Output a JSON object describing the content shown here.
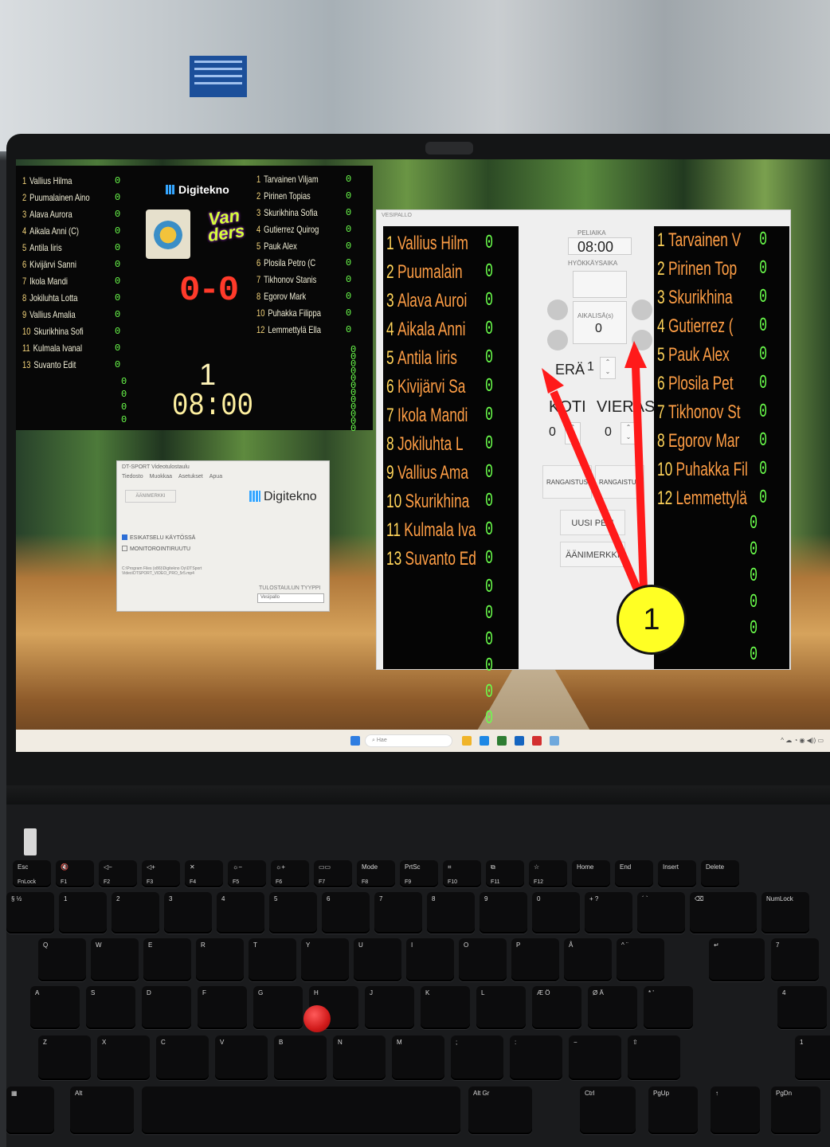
{
  "scoreboard": {
    "home_players": [
      {
        "num": "1",
        "name": "Vallius Hilma",
        "score": "0"
      },
      {
        "num": "2",
        "name": "Puumalainen Aino",
        "score": "0"
      },
      {
        "num": "3",
        "name": "Alava Aurora",
        "score": "0"
      },
      {
        "num": "4",
        "name": "Aikala Anni (C)",
        "score": "0"
      },
      {
        "num": "5",
        "name": "Antila Iiris",
        "score": "0"
      },
      {
        "num": "6",
        "name": "Kivijärvi Sanni",
        "score": "0"
      },
      {
        "num": "7",
        "name": "Ikola Mandi",
        "score": "0"
      },
      {
        "num": "8",
        "name": "Jokiluhta Lotta",
        "score": "0"
      },
      {
        "num": "9",
        "name": "Vallius Amalia",
        "score": "0"
      },
      {
        "num": "10",
        "name": "Skurikhina Sofi",
        "score": "0"
      },
      {
        "num": "11",
        "name": "Kulmala Ivanal",
        "score": "0"
      },
      {
        "num": "13",
        "name": "Suvanto Edit",
        "score": "0"
      }
    ],
    "away_players": [
      {
        "num": "1",
        "name": "Tarvainen Viljam",
        "score": "0"
      },
      {
        "num": "2",
        "name": "Pirinen Topias",
        "score": "0"
      },
      {
        "num": "3",
        "name": "Skurikhina Sofia",
        "score": "0"
      },
      {
        "num": "4",
        "name": "Gutierrez Quirog",
        "score": "0"
      },
      {
        "num": "5",
        "name": "Pauk Alex",
        "score": "0"
      },
      {
        "num": "6",
        "name": "Plosila Petro (C",
        "score": "0"
      },
      {
        "num": "7",
        "name": "Tikhonov Stanis",
        "score": "0"
      },
      {
        "num": "8",
        "name": "Egorov Mark",
        "score": "0"
      },
      {
        "num": "10",
        "name": "Puhakka Filippa",
        "score": "0"
      },
      {
        "num": "12",
        "name": "Lemmettylä Ella",
        "score": "0"
      }
    ],
    "extra_zeros": [
      "0",
      "0",
      "0",
      "0",
      "0",
      "0",
      "0",
      "0",
      "0",
      "0",
      "0",
      "0",
      "0",
      "0",
      "0",
      "0"
    ],
    "brand": "Digitekno",
    "logo_b_text": "Van ders",
    "score": "0-0",
    "period": "1",
    "clock": "08:00"
  },
  "dialog": {
    "title": "DT-SPORT Videotulostaulu",
    "menu": [
      "Tiedosto",
      "Muokkaa",
      "Asetukset",
      "Apua"
    ],
    "sound_button": "ÄÄNIMERKKI",
    "brand": "Digitekno",
    "preview_checkbox": "ESIKATSELU KÄYTÖSSÄ",
    "monitor_checkbox": "MONITOROINTIRUUTU",
    "file_path": "C:\\Program Files (x86)\\Digitekno Oy\\DTSport Video\\DTSPORT_VIDEO_PRO_5r5.mp4",
    "output_type_label": "TULOSTAULUN TYYPPI",
    "output_type_value": "Vesipallo"
  },
  "control": {
    "window_title": "VESIPALLO",
    "home_players": [
      {
        "num": "1",
        "name": "Vallius Hilm",
        "score": "0"
      },
      {
        "num": "2",
        "name": "Puumalain",
        "score": "0"
      },
      {
        "num": "3",
        "name": "Alava Auroi",
        "score": "0"
      },
      {
        "num": "4",
        "name": "Aikala Anni",
        "score": "0"
      },
      {
        "num": "5",
        "name": "Antila Iiris",
        "score": "0"
      },
      {
        "num": "6",
        "name": "Kivijärvi Sa",
        "score": "0"
      },
      {
        "num": "7",
        "name": "Ikola Mandi",
        "score": "0"
      },
      {
        "num": "8",
        "name": "Jokiluhta L",
        "score": "0"
      },
      {
        "num": "9",
        "name": "Vallius Ama",
        "score": "0"
      },
      {
        "num": "10",
        "name": "Skurikhina",
        "score": "0"
      },
      {
        "num": "11",
        "name": "Kulmala Iva",
        "score": "0"
      },
      {
        "num": "13",
        "name": "Suvanto Ed",
        "score": "0"
      }
    ],
    "away_players": [
      {
        "num": "1",
        "name": "Tarvainen V",
        "score": "0"
      },
      {
        "num": "2",
        "name": "Pirinen Top",
        "score": "0"
      },
      {
        "num": "3",
        "name": "Skurikhina",
        "score": "0"
      },
      {
        "num": "4",
        "name": "Gutierrez (",
        "score": "0"
      },
      {
        "num": "5",
        "name": "Pauk Alex",
        "score": "0"
      },
      {
        "num": "6",
        "name": "Plosila Pet",
        "score": "0"
      },
      {
        "num": "7",
        "name": "Tikhonov St",
        "score": "0"
      },
      {
        "num": "8",
        "name": "Egorov Mar",
        "score": "0"
      },
      {
        "num": "10",
        "name": "Puhakka Fil",
        "score": "0"
      },
      {
        "num": "12",
        "name": "Lemmettylä",
        "score": "0"
      }
    ],
    "extra_zeros": [
      "0",
      "0",
      "0",
      "0",
      "0",
      "0"
    ],
    "game_time_label": "PELIAIKA",
    "game_time": "08:00",
    "attack_time_label": "HYÖKKÄYSAIKA",
    "timeout_label": "AIKALISÄ(s)",
    "timeout_value": "0",
    "period_label": "ERÄ",
    "period_value": "1",
    "home_label": "KOTI",
    "away_label": "VIERAS",
    "home_score": "0",
    "away_score": "0",
    "penalty_home": "RANGAISTUS",
    "penalty_away": "RANGAISTUS",
    "new_game": "UUSI PELI",
    "sound": "ÄÄNIMERKKI"
  },
  "taskbar": {
    "search_placeholder": "Hae",
    "icon_colors": [
      "#2f7de1",
      "#f0b429",
      "#1e88e5",
      "#2e7d32",
      "#1565c0",
      "#d32f2f",
      "#6fa8dc"
    ]
  },
  "annotation": {
    "badge": "1",
    "arrow_color": "#ff1a1a",
    "badge_color": "#ffff24"
  },
  "keyboard": {
    "fn_row": [
      {
        "top": "Esc",
        "bottom": "FnLock"
      },
      {
        "top": "🔇",
        "bottom": "F1"
      },
      {
        "top": "◁−",
        "bottom": "F2"
      },
      {
        "top": "◁+",
        "bottom": "F3"
      },
      {
        "top": "✕",
        "bottom": "F4"
      },
      {
        "top": "☼−",
        "bottom": "F5"
      },
      {
        "top": "☼+",
        "bottom": "F6"
      },
      {
        "top": "▭▭",
        "bottom": "F7"
      },
      {
        "top": "Mode",
        "bottom": "F8"
      },
      {
        "top": "PrtSc",
        "bottom": "F9"
      },
      {
        "top": "⌗",
        "bottom": "F10"
      },
      {
        "top": "⧉",
        "bottom": "F11"
      },
      {
        "top": "☆",
        "bottom": "F12"
      },
      {
        "top": "Home",
        "bottom": ""
      },
      {
        "top": "End",
        "bottom": ""
      },
      {
        "top": "Insert",
        "bottom": ""
      },
      {
        "top": "Delete",
        "bottom": ""
      }
    ],
    "num_row": [
      "§ ½",
      "1",
      "2",
      "3",
      "4",
      "5",
      "6",
      "7",
      "8",
      "9",
      "0",
      "+ ?",
      "´ `",
      "⌫",
      "NumLock"
    ],
    "row_q": [
      "Q",
      "W",
      "E",
      "R",
      "T",
      "Y",
      "U",
      "I",
      "O",
      "P",
      "Å",
      "^ ¨",
      "↵",
      "7"
    ],
    "row_a": [
      "A",
      "S",
      "D",
      "F",
      "G",
      "H",
      "J",
      "K",
      "L",
      "Æ Ö",
      "Ø Ä",
      "* '",
      "4"
    ],
    "row_z": [
      "Z",
      "X",
      "C",
      "V",
      "B",
      "N",
      "M",
      ";",
      ":",
      "−",
      "⇧",
      "1"
    ],
    "bottom_row": [
      "Alt",
      "Alt Gr",
      "Ctrl",
      "PgUp",
      "↑",
      "PgDn"
    ],
    "e_sub": "€",
    "home_sub": "Home"
  }
}
